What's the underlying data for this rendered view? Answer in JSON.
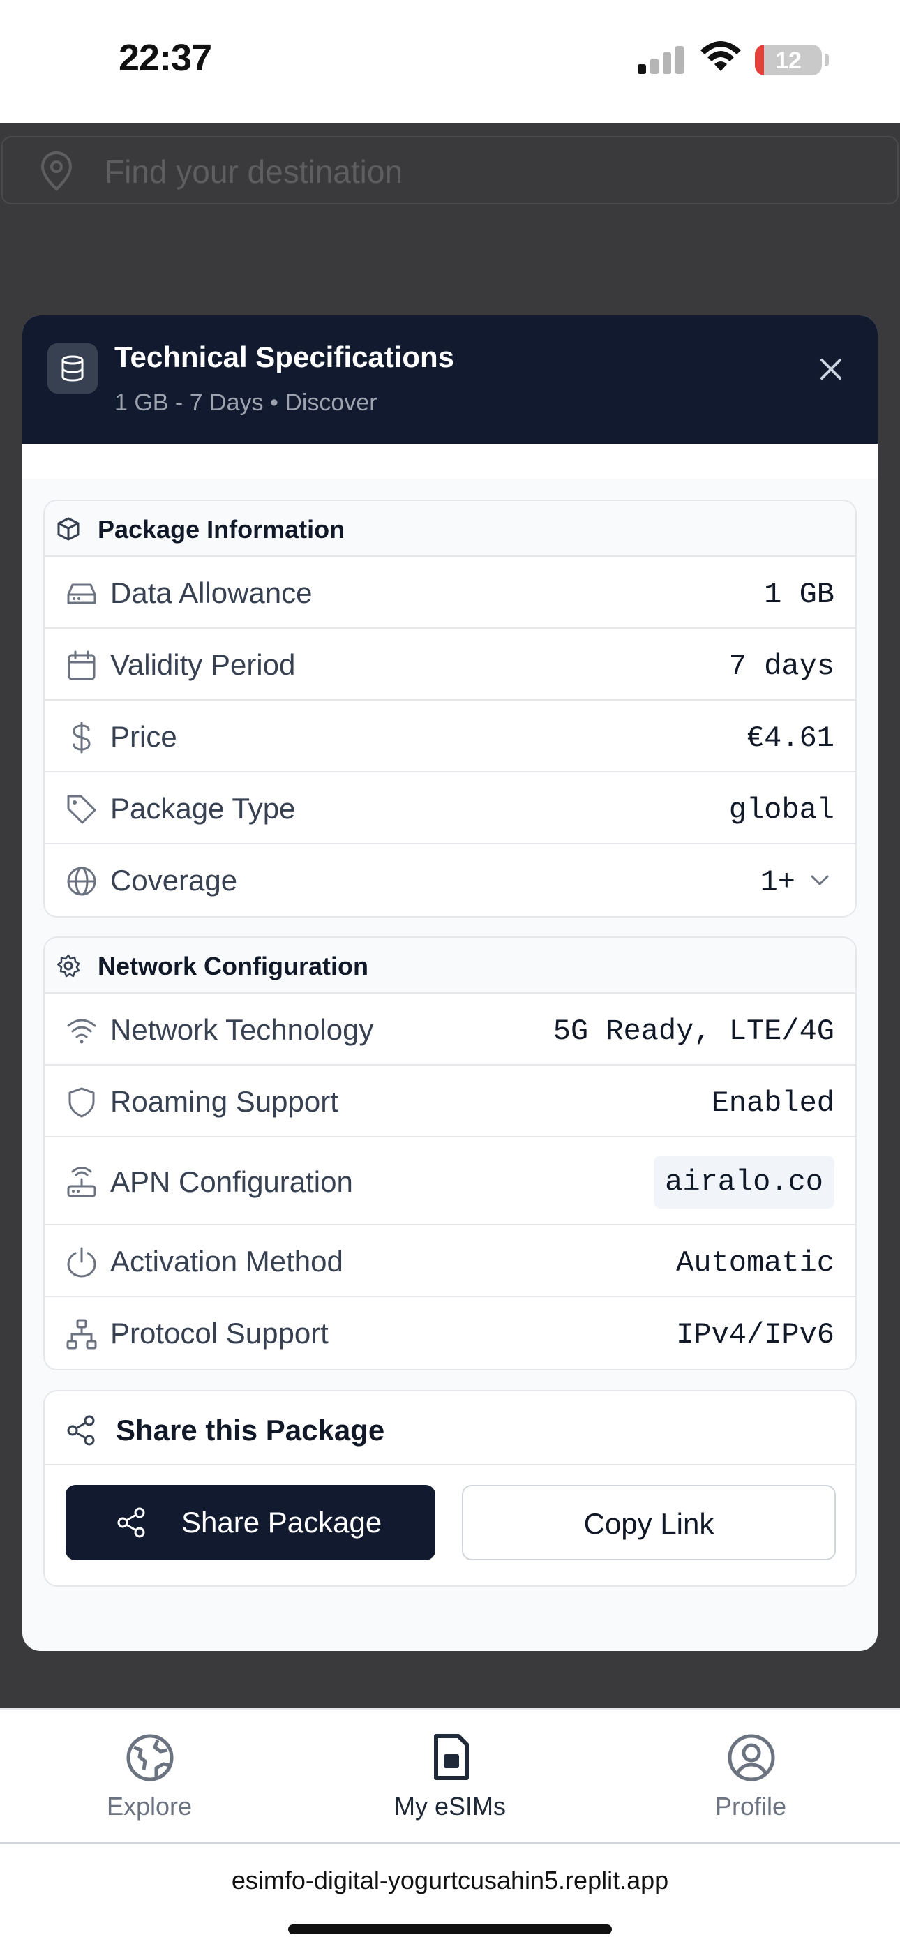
{
  "status_bar": {
    "time": "22:37",
    "battery_level": "12"
  },
  "background": {
    "search_placeholder": "Find your destination"
  },
  "modal": {
    "title": "Technical Specifications",
    "subtitle": "1 GB - 7 Days • Discover",
    "package_info": {
      "heading": "Package Information",
      "rows": [
        {
          "label": "Data Allowance",
          "value": "1 GB"
        },
        {
          "label": "Validity Period",
          "value": "7 days"
        },
        {
          "label": "Price",
          "value": "€4.61"
        },
        {
          "label": "Package Type",
          "value": "global"
        },
        {
          "label": "Coverage",
          "value": "1+"
        }
      ]
    },
    "network_config": {
      "heading": "Network Configuration",
      "rows": [
        {
          "label": "Network Technology",
          "value": "5G Ready, LTE/4G"
        },
        {
          "label": "Roaming Support",
          "value": "Enabled"
        },
        {
          "label": "APN Configuration",
          "value": "airalo.co"
        },
        {
          "label": "Activation Method",
          "value": "Automatic"
        },
        {
          "label": "Protocol Support",
          "value": "IPv4/IPv6"
        }
      ]
    },
    "share": {
      "heading": "Share this Package",
      "share_button": "Share Package",
      "copy_button": "Copy Link"
    }
  },
  "bottom_nav": {
    "items": [
      {
        "label": "Explore",
        "icon": "globe-icon"
      },
      {
        "label": "My eSIMs",
        "icon": "sim-card-icon",
        "active": true
      },
      {
        "label": "Profile",
        "icon": "user-circle-icon"
      }
    ]
  },
  "browser": {
    "url": "esimfo-digital-yogurtcusahin5.replit.app"
  },
  "colors": {
    "header_bg": "#111a2e",
    "overlay": "#3a3a3c",
    "battery_low": "#e5413b"
  }
}
